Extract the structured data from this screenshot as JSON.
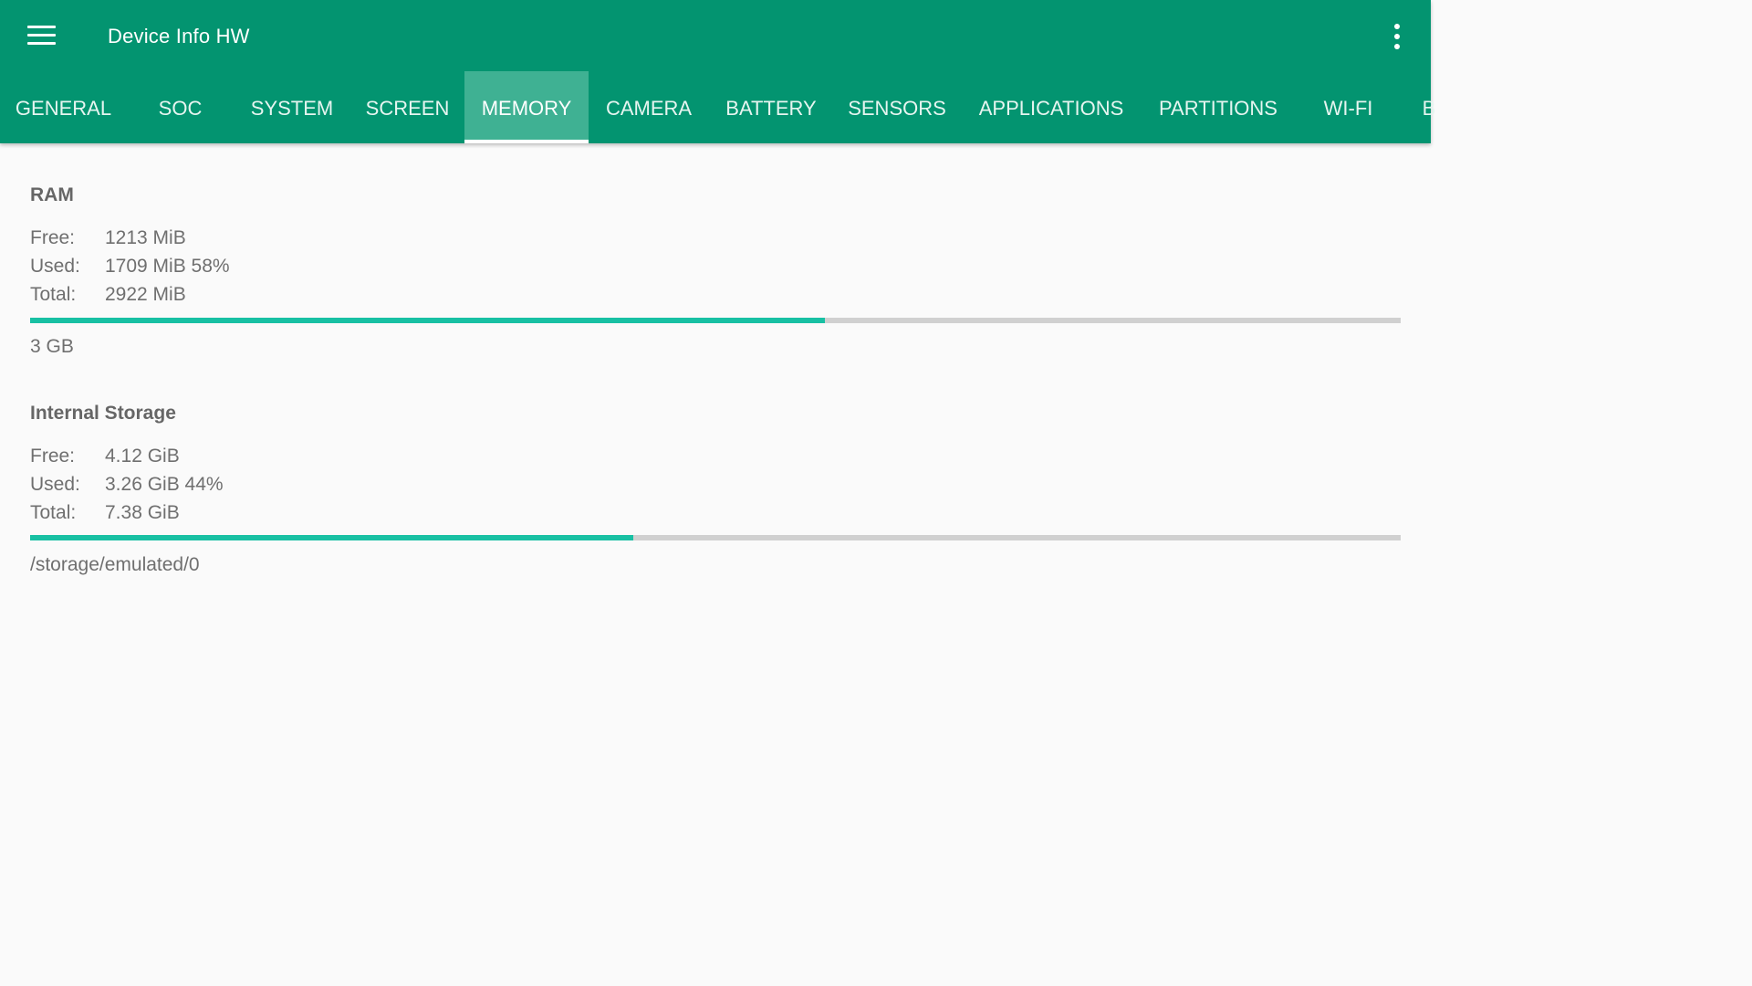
{
  "app": {
    "title": "Device Info HW",
    "icons": {
      "menu": "menu-icon",
      "overflow": "more-vert-icon"
    },
    "colors": {
      "primary": "#039470",
      "active_tab": "#3fb193",
      "progress": "#18c0a3",
      "track": "#d0d0d0"
    }
  },
  "tabs": [
    {
      "label": "GENERAL"
    },
    {
      "label": "SOC"
    },
    {
      "label": "SYSTEM"
    },
    {
      "label": "SCREEN"
    },
    {
      "label": "MEMORY",
      "active": true
    },
    {
      "label": "CAMERA"
    },
    {
      "label": "BATTERY"
    },
    {
      "label": "SENSORS"
    },
    {
      "label": "APPLICATIONS"
    },
    {
      "label": "PARTITIONS"
    },
    {
      "label": "WI-FI"
    },
    {
      "label": "B"
    }
  ],
  "ram": {
    "title": "RAM",
    "free_label": "Free:",
    "free_value": "1213 MiB",
    "used_label": "Used:",
    "used_value": "1709 MiB 58%",
    "total_label": "Total:",
    "total_value": "2922 MiB",
    "used_fraction": 0.58,
    "caption": "3 GB"
  },
  "storage": {
    "title": "Internal Storage",
    "free_label": "Free:",
    "free_value": "4.12 GiB",
    "used_label": "Used:",
    "used_value": "3.26 GiB 44%",
    "total_label": "Total:",
    "total_value": "7.38 GiB",
    "used_fraction": 0.44,
    "caption": "/storage/emulated/0"
  }
}
